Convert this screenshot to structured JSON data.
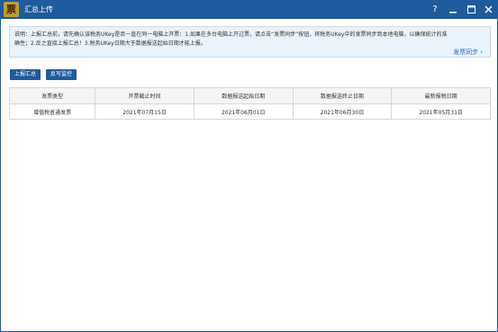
{
  "window": {
    "logo_char": "票",
    "title": "汇总上传",
    "controls": {
      "help": "?",
      "minimize": "minimize-icon",
      "maximize": "maximize-icon",
      "close": "close-icon"
    }
  },
  "notice": {
    "line1": "说明：上报汇总前，请先确认该税务UKey是否一直在同一电脑上开票：1.如果在多台电脑上开过票，请点击“发票同步”按钮，将税务UKey中的发票同步到本地电脑，以确保统计的准",
    "line2": "确性；2.反之直接上报汇总！3.税务UKey日期大于数据报送起始日期才能上报。",
    "sync_link": "发票同步"
  },
  "actions": {
    "report_summary": "上报汇总",
    "feedback_monitor": "反写监控"
  },
  "table": {
    "headers": [
      "发票类型",
      "开票截止时间",
      "数据报送起始日期",
      "数据报送终止日期",
      "最新报税日期"
    ],
    "rows": [
      [
        "增值税普通发票",
        "2021年07月15日",
        "2021年06月01日",
        "2021年06月30日",
        "2021年05月31日"
      ]
    ]
  },
  "colors": {
    "titlebar": "#1f5b9d",
    "button": "#1f5b9d",
    "notice_bg": "#eaf3fb",
    "link": "#2a6fb8"
  }
}
